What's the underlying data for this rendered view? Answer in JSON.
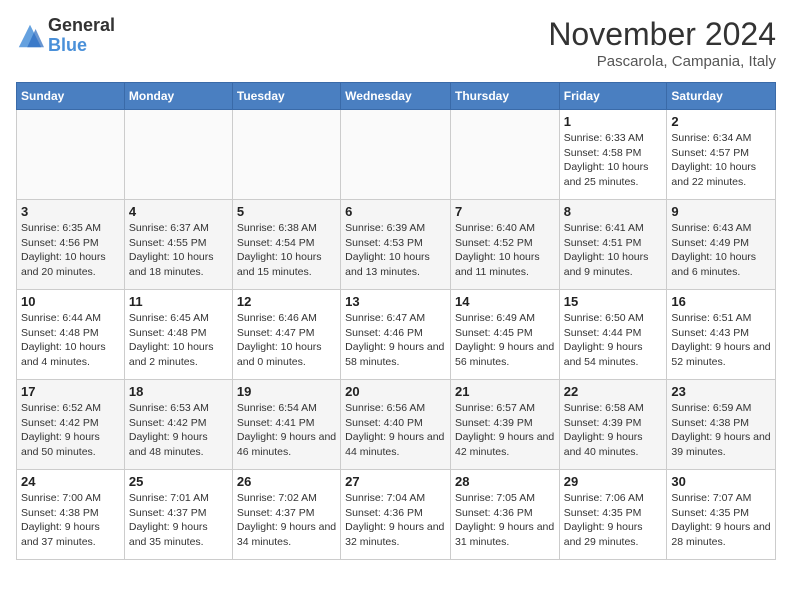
{
  "header": {
    "logo": {
      "line1": "General",
      "line2": "Blue"
    },
    "title": "November 2024",
    "location": "Pascarola, Campania, Italy"
  },
  "weekdays": [
    "Sunday",
    "Monday",
    "Tuesday",
    "Wednesday",
    "Thursday",
    "Friday",
    "Saturday"
  ],
  "weeks": [
    [
      {
        "day": "",
        "info": ""
      },
      {
        "day": "",
        "info": ""
      },
      {
        "day": "",
        "info": ""
      },
      {
        "day": "",
        "info": ""
      },
      {
        "day": "",
        "info": ""
      },
      {
        "day": "1",
        "info": "Sunrise: 6:33 AM\nSunset: 4:58 PM\nDaylight: 10 hours and 25 minutes."
      },
      {
        "day": "2",
        "info": "Sunrise: 6:34 AM\nSunset: 4:57 PM\nDaylight: 10 hours and 22 minutes."
      }
    ],
    [
      {
        "day": "3",
        "info": "Sunrise: 6:35 AM\nSunset: 4:56 PM\nDaylight: 10 hours and 20 minutes."
      },
      {
        "day": "4",
        "info": "Sunrise: 6:37 AM\nSunset: 4:55 PM\nDaylight: 10 hours and 18 minutes."
      },
      {
        "day": "5",
        "info": "Sunrise: 6:38 AM\nSunset: 4:54 PM\nDaylight: 10 hours and 15 minutes."
      },
      {
        "day": "6",
        "info": "Sunrise: 6:39 AM\nSunset: 4:53 PM\nDaylight: 10 hours and 13 minutes."
      },
      {
        "day": "7",
        "info": "Sunrise: 6:40 AM\nSunset: 4:52 PM\nDaylight: 10 hours and 11 minutes."
      },
      {
        "day": "8",
        "info": "Sunrise: 6:41 AM\nSunset: 4:51 PM\nDaylight: 10 hours and 9 minutes."
      },
      {
        "day": "9",
        "info": "Sunrise: 6:43 AM\nSunset: 4:49 PM\nDaylight: 10 hours and 6 minutes."
      }
    ],
    [
      {
        "day": "10",
        "info": "Sunrise: 6:44 AM\nSunset: 4:48 PM\nDaylight: 10 hours and 4 minutes."
      },
      {
        "day": "11",
        "info": "Sunrise: 6:45 AM\nSunset: 4:48 PM\nDaylight: 10 hours and 2 minutes."
      },
      {
        "day": "12",
        "info": "Sunrise: 6:46 AM\nSunset: 4:47 PM\nDaylight: 10 hours and 0 minutes."
      },
      {
        "day": "13",
        "info": "Sunrise: 6:47 AM\nSunset: 4:46 PM\nDaylight: 9 hours and 58 minutes."
      },
      {
        "day": "14",
        "info": "Sunrise: 6:49 AM\nSunset: 4:45 PM\nDaylight: 9 hours and 56 minutes."
      },
      {
        "day": "15",
        "info": "Sunrise: 6:50 AM\nSunset: 4:44 PM\nDaylight: 9 hours and 54 minutes."
      },
      {
        "day": "16",
        "info": "Sunrise: 6:51 AM\nSunset: 4:43 PM\nDaylight: 9 hours and 52 minutes."
      }
    ],
    [
      {
        "day": "17",
        "info": "Sunrise: 6:52 AM\nSunset: 4:42 PM\nDaylight: 9 hours and 50 minutes."
      },
      {
        "day": "18",
        "info": "Sunrise: 6:53 AM\nSunset: 4:42 PM\nDaylight: 9 hours and 48 minutes."
      },
      {
        "day": "19",
        "info": "Sunrise: 6:54 AM\nSunset: 4:41 PM\nDaylight: 9 hours and 46 minutes."
      },
      {
        "day": "20",
        "info": "Sunrise: 6:56 AM\nSunset: 4:40 PM\nDaylight: 9 hours and 44 minutes."
      },
      {
        "day": "21",
        "info": "Sunrise: 6:57 AM\nSunset: 4:39 PM\nDaylight: 9 hours and 42 minutes."
      },
      {
        "day": "22",
        "info": "Sunrise: 6:58 AM\nSunset: 4:39 PM\nDaylight: 9 hours and 40 minutes."
      },
      {
        "day": "23",
        "info": "Sunrise: 6:59 AM\nSunset: 4:38 PM\nDaylight: 9 hours and 39 minutes."
      }
    ],
    [
      {
        "day": "24",
        "info": "Sunrise: 7:00 AM\nSunset: 4:38 PM\nDaylight: 9 hours and 37 minutes."
      },
      {
        "day": "25",
        "info": "Sunrise: 7:01 AM\nSunset: 4:37 PM\nDaylight: 9 hours and 35 minutes."
      },
      {
        "day": "26",
        "info": "Sunrise: 7:02 AM\nSunset: 4:37 PM\nDaylight: 9 hours and 34 minutes."
      },
      {
        "day": "27",
        "info": "Sunrise: 7:04 AM\nSunset: 4:36 PM\nDaylight: 9 hours and 32 minutes."
      },
      {
        "day": "28",
        "info": "Sunrise: 7:05 AM\nSunset: 4:36 PM\nDaylight: 9 hours and 31 minutes."
      },
      {
        "day": "29",
        "info": "Sunrise: 7:06 AM\nSunset: 4:35 PM\nDaylight: 9 hours and 29 minutes."
      },
      {
        "day": "30",
        "info": "Sunrise: 7:07 AM\nSunset: 4:35 PM\nDaylight: 9 hours and 28 minutes."
      }
    ]
  ]
}
